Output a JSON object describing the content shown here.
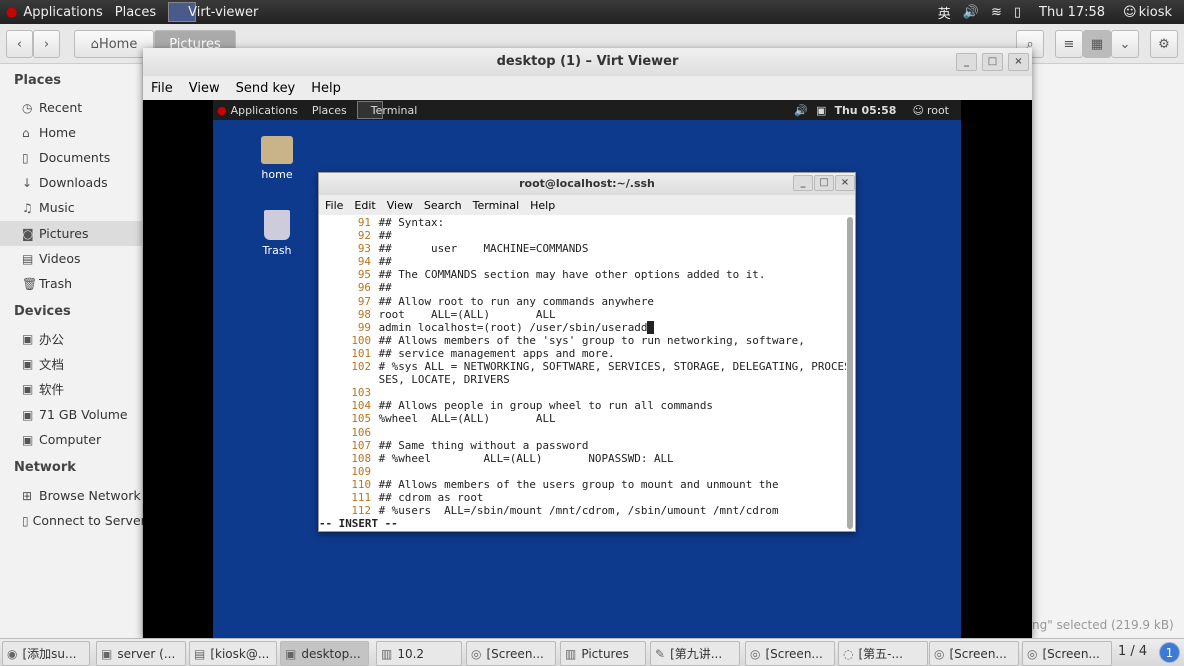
{
  "topbar": {
    "applications": "Applications",
    "places": "Places",
    "window": "Virt-viewer",
    "ime": "英",
    "clock": "Thu 17:58",
    "user": "kiosk"
  },
  "nautilus": {
    "home": "Home",
    "pictures": "Pictures",
    "status": "ng\" selected  (219.9 kB)",
    "sidebar": {
      "places_header": "Places",
      "places": [
        "Recent",
        "Home",
        "Documents",
        "Downloads",
        "Music",
        "Pictures",
        "Videos",
        "Trash"
      ],
      "devices_header": "Devices",
      "devices": [
        "办公",
        "文档",
        "软件",
        "71 GB Volume",
        "Computer"
      ],
      "network_header": "Network",
      "network": [
        "Browse Network",
        "Connect to Server"
      ]
    }
  },
  "virt": {
    "title": "desktop (1) – Virt Viewer",
    "menu": [
      "File",
      "View",
      "Send key",
      "Help"
    ]
  },
  "guest": {
    "applications": "Applications",
    "places": "Places",
    "terminal": "Terminal",
    "clock": "Thu 05:58",
    "user": "root",
    "icons": [
      "home",
      "Trash"
    ]
  },
  "terminal": {
    "title": "root@localhost:~/.ssh",
    "menu": [
      "File",
      "Edit",
      "View",
      "Search",
      "Terminal",
      "Help"
    ],
    "lines": [
      [
        "91",
        "## Syntax:"
      ],
      [
        "92",
        "##"
      ],
      [
        "93",
        "##      user    MACHINE=COMMANDS"
      ],
      [
        "94",
        "##"
      ],
      [
        "95",
        "## The COMMANDS section may have other options added to it."
      ],
      [
        "96",
        "##"
      ],
      [
        "97",
        "## Allow root to run any commands anywhere"
      ],
      [
        "98",
        "root    ALL=(ALL)       ALL"
      ],
      [
        "99",
        "admin localhost=(root) /user/sbin/useradd"
      ],
      [
        "100",
        "## Allows members of the 'sys' group to run networking, software,"
      ],
      [
        "101",
        "## service management apps and more."
      ],
      [
        "102",
        "# %sys ALL = NETWORKING, SOFTWARE, SERVICES, STORAGE, DELEGATING, PROCES"
      ],
      [
        "",
        "SES, LOCATE, DRIVERS"
      ],
      [
        "103",
        ""
      ],
      [
        "104",
        "## Allows people in group wheel to run all commands"
      ],
      [
        "105",
        "%wheel  ALL=(ALL)       ALL"
      ],
      [
        "106",
        ""
      ],
      [
        "107",
        "## Same thing without a password"
      ],
      [
        "108",
        "# %wheel        ALL=(ALL)       NOPASSWD: ALL"
      ],
      [
        "109",
        ""
      ],
      [
        "110",
        "## Allows members of the users group to mount and unmount the"
      ],
      [
        "111",
        "## cdrom as root"
      ],
      [
        "112",
        "# %users  ALL=/sbin/mount /mnt/cdrom, /sbin/umount /mnt/cdrom"
      ]
    ],
    "mode": "-- INSERT --"
  },
  "taskbar": {
    "items": [
      "[添加su...",
      "server (...",
      "[kiosk@...",
      "desktop...",
      "10.2",
      "[Screen...",
      "Pictures",
      "[第九讲...",
      "[Screen...",
      "[第五-...",
      "[Screen...",
      "[Screen..."
    ],
    "active": 3,
    "workspace": "1 / 4",
    "notification": "1"
  }
}
